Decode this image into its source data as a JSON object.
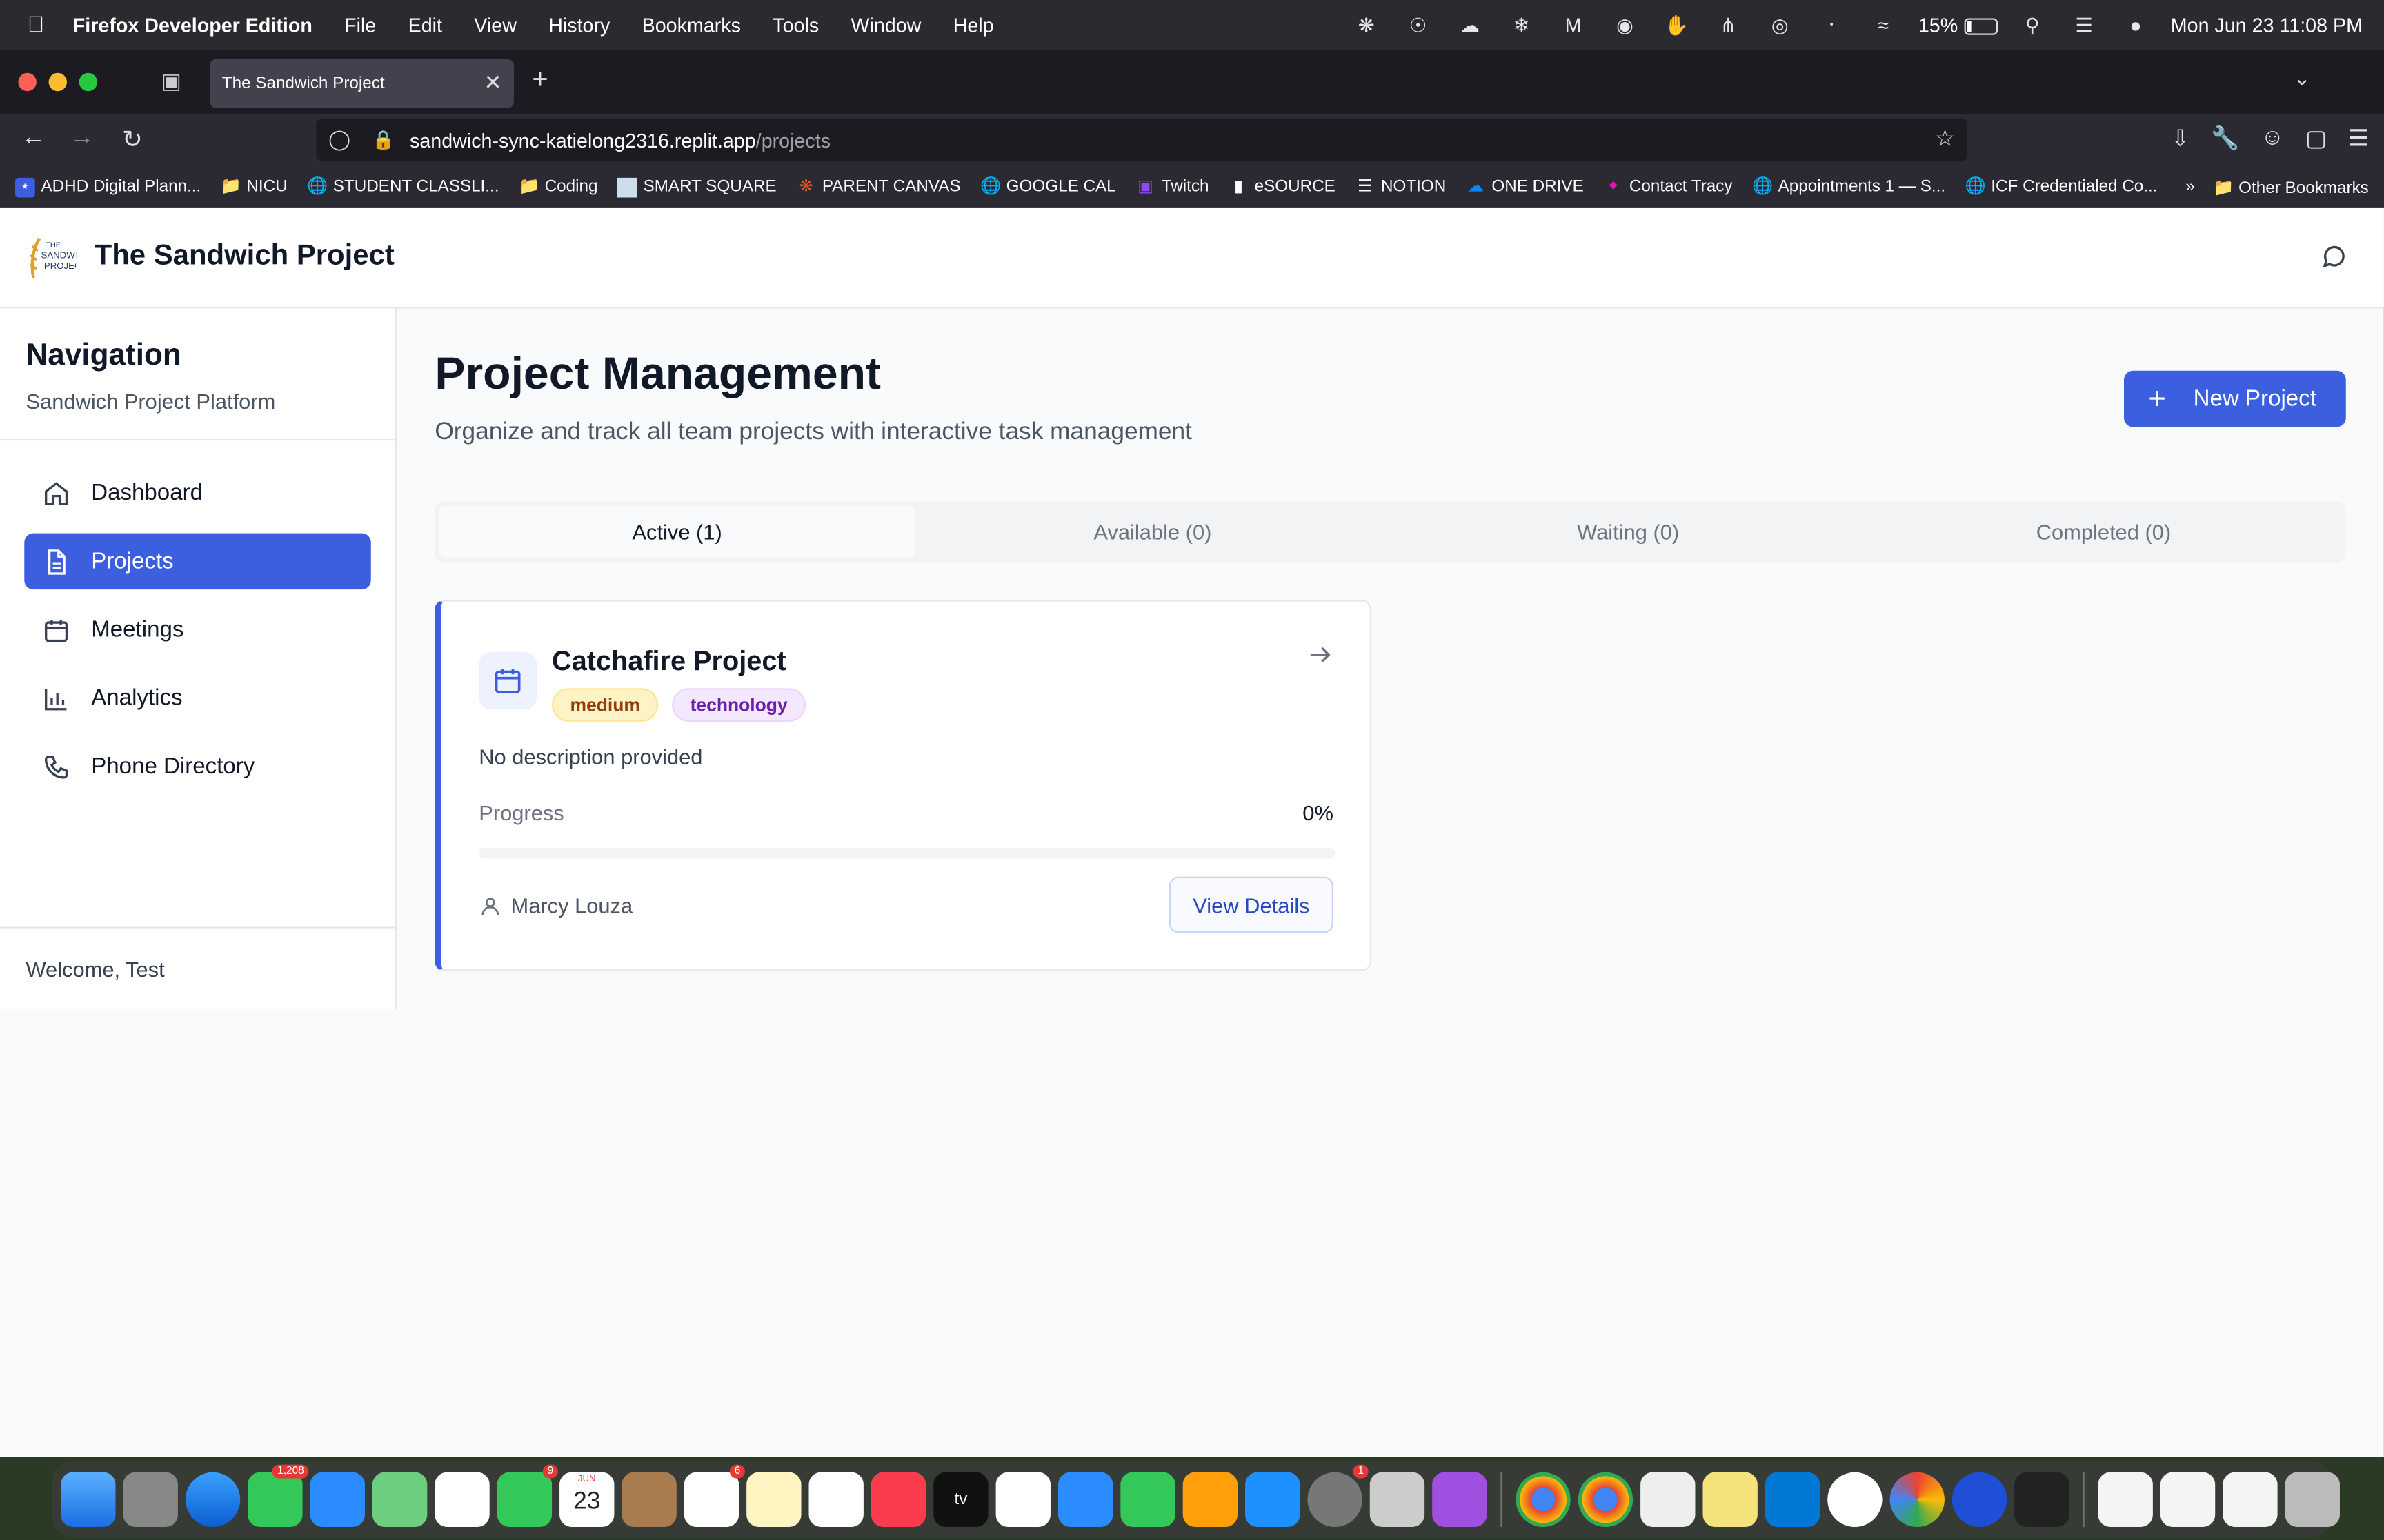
{
  "menubar": {
    "app_name": "Firefox Developer Edition",
    "menus": [
      "File",
      "Edit",
      "View",
      "History",
      "Bookmarks",
      "Tools",
      "Window",
      "Help"
    ],
    "battery": "15%",
    "datetime": "Mon Jun 23  11:08 PM"
  },
  "browser": {
    "tab_title": "The Sandwich Project",
    "url_host": "sandwich-sync-katielong2316.replit.app",
    "url_path": "/projects",
    "bookmarks": [
      "ADHD Digital Plann...",
      "NICU",
      "STUDENT CLASSLI...",
      "Coding",
      "SMART SQUARE",
      "PARENT CANVAS",
      "GOOGLE CAL",
      "Twitch",
      "eSOURCE",
      "NOTION",
      "ONE DRIVE",
      "Contact Tracy",
      "Appointments 1 — S...",
      "ICF Credentialed Co..."
    ],
    "other_bookmarks": "Other Bookmarks"
  },
  "app": {
    "title": "The Sandwich Project"
  },
  "sidebar": {
    "title": "Navigation",
    "subtitle": "Sandwich Project Platform",
    "items": [
      {
        "label": "Dashboard",
        "icon": "home-icon"
      },
      {
        "label": "Projects",
        "icon": "document-icon",
        "active": true
      },
      {
        "label": "Meetings",
        "icon": "calendar-icon"
      },
      {
        "label": "Analytics",
        "icon": "bar-chart-icon"
      },
      {
        "label": "Phone Directory",
        "icon": "phone-icon"
      }
    ],
    "welcome": "Welcome, Test"
  },
  "main": {
    "title": "Project Management",
    "subtitle": "Organize and track all team projects with interactive task management",
    "new_project_label": "New Project",
    "tabs": [
      {
        "label": "Active (1)",
        "active": true
      },
      {
        "label": "Available (0)"
      },
      {
        "label": "Waiting (0)"
      },
      {
        "label": "Completed (0)"
      }
    ],
    "project": {
      "name": "Catchafire Project",
      "priority": "medium",
      "category": "technology",
      "description": "No description provided",
      "progress_label": "Progress",
      "progress_text": "0%",
      "progress_value": 0,
      "owner": "Marcy Louza",
      "view_label": "View Details"
    }
  },
  "dock": {
    "badges": {
      "messages": "1,208",
      "facetime": "9",
      "calendar_day": "23",
      "calendar_month": "JUN",
      "reminders": "6",
      "settings": "1"
    }
  },
  "colors": {
    "accent": "#3b5fdf",
    "priority_medium_bg": "#fef3c7",
    "category_bg": "#f3e8ff"
  }
}
